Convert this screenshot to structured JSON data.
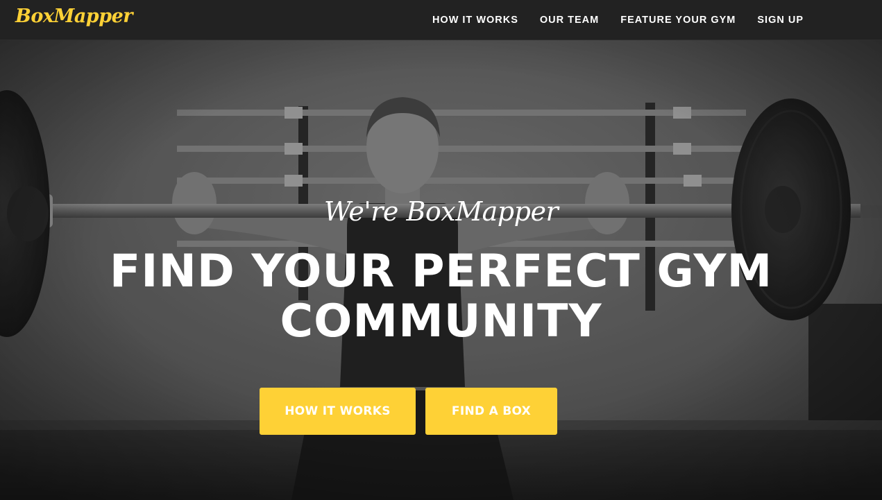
{
  "navbar": {
    "brand": "BoxMapper",
    "links": [
      "HOW IT WORKS",
      "OUR TEAM",
      "FEATURE YOUR GYM",
      "SIGN UP"
    ]
  },
  "hero": {
    "lead_in": "We're BoxMapper",
    "heading": "FIND YOUR PERFECT GYM COMMUNITY",
    "buttons": {
      "how_it_works": "HOW IT WORKS",
      "find_a_box": "FIND A BOX"
    }
  },
  "colors": {
    "accent": "#fed136",
    "navbar_bg": "#222222",
    "text": "#ffffff"
  }
}
